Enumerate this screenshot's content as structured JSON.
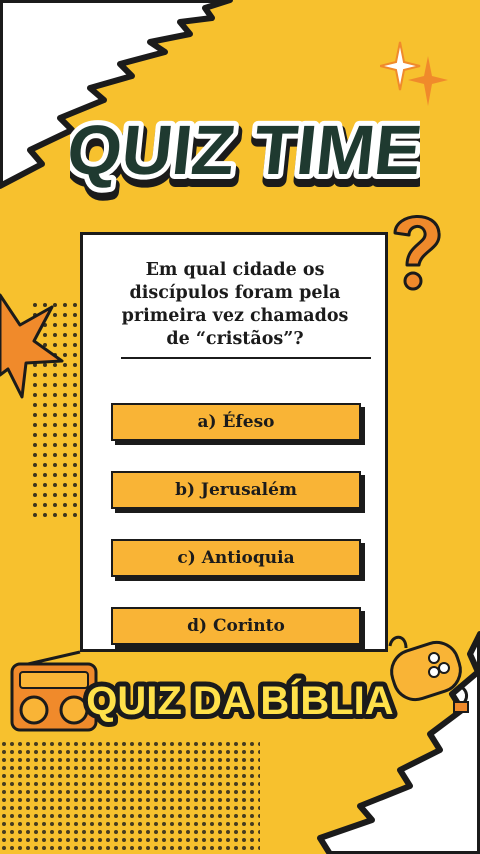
{
  "header": {
    "title": "QUIZ TIME"
  },
  "quiz": {
    "question": "Em qual cidade os discípulos foram pela primeira vez chamados de “cristãos”?",
    "options": [
      {
        "label": "a) Éfeso"
      },
      {
        "label": "b) Jerusalém"
      },
      {
        "label": "c) Antioquia"
      },
      {
        "label": "d) Corinto"
      }
    ]
  },
  "footer": {
    "subtitle": "QUIZ DA BÍBLIA"
  },
  "icons": [
    "sparkle-icon",
    "question-mark-icon",
    "starburst-icon",
    "radio-icon",
    "game-controller-icon"
  ],
  "colors": {
    "background": "#f7c12e",
    "answer": "#f9b436",
    "accent_orange": "#f08a2b",
    "title_fill": "#1f3a30",
    "subtitle_fill": "#ffe14a",
    "outline": "#1b1b1b"
  }
}
